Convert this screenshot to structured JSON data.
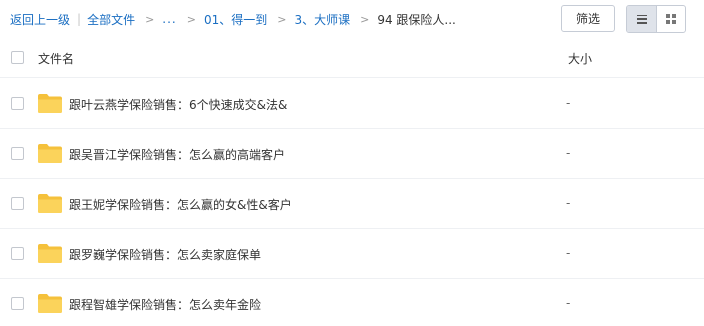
{
  "breadcrumb": {
    "back": "返回上一级",
    "all_files": "全部文件",
    "ellipsis": "...",
    "items": [
      "01、得一到",
      "3、大师课"
    ],
    "current": "94 跟保险人..."
  },
  "toolbar": {
    "filter_label": "筛选"
  },
  "table": {
    "col_name": "文件名",
    "col_size": "大小"
  },
  "files": [
    {
      "name": "跟叶云燕学保险销售：6个快速成交&法&",
      "size": "-"
    },
    {
      "name": "跟吴晋江学保险销售：怎么赢的高端客户",
      "size": "-"
    },
    {
      "name": "跟王妮学保险销售：怎么赢的女&性&客户",
      "size": "-"
    },
    {
      "name": "跟罗巍学保险销售：怎么卖家庭保单",
      "size": "-"
    },
    {
      "name": "跟程智雄学保险销售：怎么卖年金险",
      "size": "-"
    }
  ],
  "colors": {
    "link": "#1a6ec2",
    "folder": "#f7c948"
  }
}
